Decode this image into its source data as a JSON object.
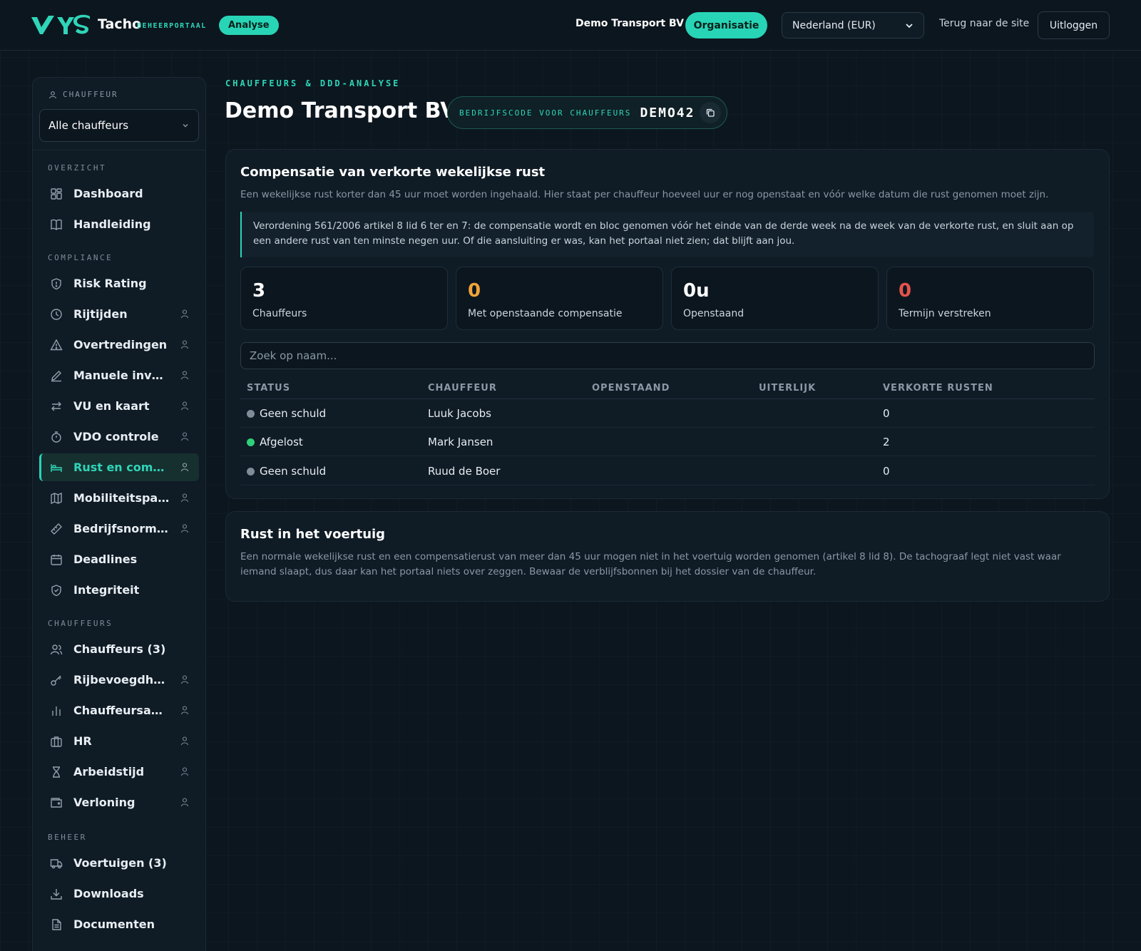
{
  "topbar": {
    "brand": "Tacho",
    "brand_sub": "BEHEERPORTAAL",
    "analyse_label": "Analyse",
    "org_name": "Demo Transport BV",
    "org_button": "Organisatie",
    "country_select": "Nederland (EUR)",
    "back_link": "Terug naar de site",
    "logout": "Uitloggen"
  },
  "sidebar": {
    "chauffeur_head": "CHAUFFEUR",
    "chauffeur_select": "Alle chauffeurs",
    "sections": {
      "overzicht": "OVERZICHT",
      "compliance": "COMPLIANCE",
      "chauffeurs": "CHAUFFEURS",
      "beheer": "BEHEER"
    },
    "items": [
      {
        "label": "Dashboard",
        "icon": "dashboard-icon"
      },
      {
        "label": "Handleiding",
        "icon": "book-icon"
      },
      {
        "label": "Risk Rating",
        "icon": "shield-icon"
      },
      {
        "label": "Rijtijden",
        "icon": "clock-icon"
      },
      {
        "label": "Overtredingen",
        "icon": "warning-icon"
      },
      {
        "label": "Manuele invoer",
        "icon": "pencil-icon"
      },
      {
        "label": "VU en kaart",
        "icon": "swap-icon"
      },
      {
        "label": "VDO controle",
        "icon": "stopwatch-icon"
      },
      {
        "label": "Rust en compen…",
        "icon": "bed-icon"
      },
      {
        "label": "Mobiliteitspakket",
        "icon": "map-icon"
      },
      {
        "label": "Bedrijfsnormen",
        "icon": "ruler-icon"
      },
      {
        "label": "Deadlines",
        "icon": "calendar-icon"
      },
      {
        "label": "Integriteit",
        "icon": "shield-check-icon"
      },
      {
        "label": "Chauffeurs (3)",
        "icon": "users-icon"
      },
      {
        "label": "Rijbevoegdheid",
        "icon": "key-icon"
      },
      {
        "label": "Chauffeursanaly…",
        "icon": "bar-chart-icon"
      },
      {
        "label": "HR",
        "icon": "briefcase-icon"
      },
      {
        "label": "Arbeidstijd",
        "icon": "hourglass-icon"
      },
      {
        "label": "Verloning",
        "icon": "wallet-icon"
      },
      {
        "label": "Voertuigen (3)",
        "icon": "truck-icon"
      },
      {
        "label": "Downloads",
        "icon": "download-icon"
      },
      {
        "label": "Documenten",
        "icon": "document-icon"
      }
    ]
  },
  "main": {
    "eyebrow": "CHAUFFEURS & DDD-ANALYSE",
    "title": "Demo Transport BV",
    "code_label": "BEDRIJFSCODE VOOR CHAUFFEURS",
    "code_value": "DEMO42",
    "compensation": {
      "title": "Compensatie van verkorte wekelijkse rust",
      "description": "Een wekelijkse rust korter dan 45 uur moet worden ingehaald. Hier staat per chauffeur hoeveel uur er nog openstaat en vóór welke datum die rust genomen moet zijn.",
      "callout": "Verordening 561/2006 artikel 8 lid 6 ter en 7: de compensatie wordt en bloc genomen vóór het einde van de derde week na de week van de verkorte rust, en sluit aan op een andere rust van ten minste negen uur. Of die aansluiting er was, kan het portaal niet zien; dat blijft aan jou.",
      "stats": [
        {
          "value": "3",
          "label": "Chauffeurs",
          "color": "#ffffff"
        },
        {
          "value": "0",
          "label": "Met openstaande compensatie",
          "color": "#f0a43a"
        },
        {
          "value": "0u",
          "label": "Openstaand",
          "color": "#ffffff"
        },
        {
          "value": "0",
          "label": "Termijn verstreken",
          "color": "#e5534b"
        }
      ],
      "search_placeholder": "Zoek op naam...",
      "columns": [
        "STATUS",
        "CHAUFFEUR",
        "OPENSTAAND",
        "UITERLIJK",
        "VERKORTE RUSTEN"
      ],
      "rows": [
        {
          "status": "Geen schuld",
          "status_color": "#7f8d99",
          "driver": "Luuk Jacobs",
          "open": "",
          "deadline": "",
          "shortened": "0"
        },
        {
          "status": "Afgelost",
          "status_color": "#2fd07a",
          "driver": "Mark Jansen",
          "open": "",
          "deadline": "",
          "shortened": "2"
        },
        {
          "status": "Geen schuld",
          "status_color": "#7f8d99",
          "driver": "Ruud de Boer",
          "open": "",
          "deadline": "",
          "shortened": "0"
        }
      ]
    },
    "vehicle_rest": {
      "title": "Rust in het voertuig",
      "description": "Een normale wekelijkse rust en een compensatierust van meer dan 45 uur mogen niet in het voertuig worden genomen (artikel 8 lid 8). De tachograaf legt niet vast waar iemand slaapt, dus daar kan het portaal niets over zeggen. Bewaar de verblijfsbonnen bij het dossier van de chauffeur."
    }
  },
  "colors": {
    "accent": "#28d4b6",
    "background": "#0c161f",
    "panel": "#0f1b25"
  }
}
